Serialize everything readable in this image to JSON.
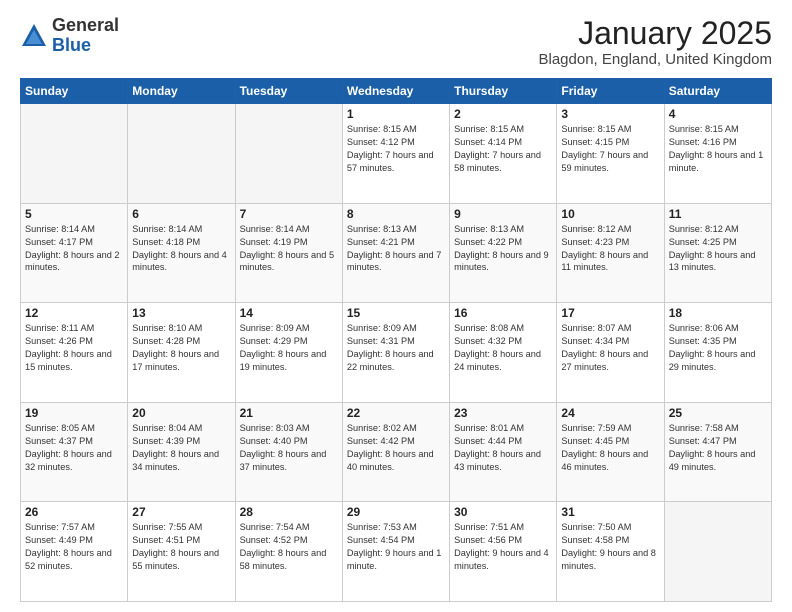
{
  "header": {
    "logo_general": "General",
    "logo_blue": "Blue",
    "title": "January 2025",
    "subtitle": "Blagdon, England, United Kingdom"
  },
  "weekdays": [
    "Sunday",
    "Monday",
    "Tuesday",
    "Wednesday",
    "Thursday",
    "Friday",
    "Saturday"
  ],
  "weeks": [
    [
      {
        "day": "",
        "info": ""
      },
      {
        "day": "",
        "info": ""
      },
      {
        "day": "",
        "info": ""
      },
      {
        "day": "1",
        "info": "Sunrise: 8:15 AM\nSunset: 4:12 PM\nDaylight: 7 hours and 57 minutes."
      },
      {
        "day": "2",
        "info": "Sunrise: 8:15 AM\nSunset: 4:14 PM\nDaylight: 7 hours and 58 minutes."
      },
      {
        "day": "3",
        "info": "Sunrise: 8:15 AM\nSunset: 4:15 PM\nDaylight: 7 hours and 59 minutes."
      },
      {
        "day": "4",
        "info": "Sunrise: 8:15 AM\nSunset: 4:16 PM\nDaylight: 8 hours and 1 minute."
      }
    ],
    [
      {
        "day": "5",
        "info": "Sunrise: 8:14 AM\nSunset: 4:17 PM\nDaylight: 8 hours and 2 minutes."
      },
      {
        "day": "6",
        "info": "Sunrise: 8:14 AM\nSunset: 4:18 PM\nDaylight: 8 hours and 4 minutes."
      },
      {
        "day": "7",
        "info": "Sunrise: 8:14 AM\nSunset: 4:19 PM\nDaylight: 8 hours and 5 minutes."
      },
      {
        "day": "8",
        "info": "Sunrise: 8:13 AM\nSunset: 4:21 PM\nDaylight: 8 hours and 7 minutes."
      },
      {
        "day": "9",
        "info": "Sunrise: 8:13 AM\nSunset: 4:22 PM\nDaylight: 8 hours and 9 minutes."
      },
      {
        "day": "10",
        "info": "Sunrise: 8:12 AM\nSunset: 4:23 PM\nDaylight: 8 hours and 11 minutes."
      },
      {
        "day": "11",
        "info": "Sunrise: 8:12 AM\nSunset: 4:25 PM\nDaylight: 8 hours and 13 minutes."
      }
    ],
    [
      {
        "day": "12",
        "info": "Sunrise: 8:11 AM\nSunset: 4:26 PM\nDaylight: 8 hours and 15 minutes."
      },
      {
        "day": "13",
        "info": "Sunrise: 8:10 AM\nSunset: 4:28 PM\nDaylight: 8 hours and 17 minutes."
      },
      {
        "day": "14",
        "info": "Sunrise: 8:09 AM\nSunset: 4:29 PM\nDaylight: 8 hours and 19 minutes."
      },
      {
        "day": "15",
        "info": "Sunrise: 8:09 AM\nSunset: 4:31 PM\nDaylight: 8 hours and 22 minutes."
      },
      {
        "day": "16",
        "info": "Sunrise: 8:08 AM\nSunset: 4:32 PM\nDaylight: 8 hours and 24 minutes."
      },
      {
        "day": "17",
        "info": "Sunrise: 8:07 AM\nSunset: 4:34 PM\nDaylight: 8 hours and 27 minutes."
      },
      {
        "day": "18",
        "info": "Sunrise: 8:06 AM\nSunset: 4:35 PM\nDaylight: 8 hours and 29 minutes."
      }
    ],
    [
      {
        "day": "19",
        "info": "Sunrise: 8:05 AM\nSunset: 4:37 PM\nDaylight: 8 hours and 32 minutes."
      },
      {
        "day": "20",
        "info": "Sunrise: 8:04 AM\nSunset: 4:39 PM\nDaylight: 8 hours and 34 minutes."
      },
      {
        "day": "21",
        "info": "Sunrise: 8:03 AM\nSunset: 4:40 PM\nDaylight: 8 hours and 37 minutes."
      },
      {
        "day": "22",
        "info": "Sunrise: 8:02 AM\nSunset: 4:42 PM\nDaylight: 8 hours and 40 minutes."
      },
      {
        "day": "23",
        "info": "Sunrise: 8:01 AM\nSunset: 4:44 PM\nDaylight: 8 hours and 43 minutes."
      },
      {
        "day": "24",
        "info": "Sunrise: 7:59 AM\nSunset: 4:45 PM\nDaylight: 8 hours and 46 minutes."
      },
      {
        "day": "25",
        "info": "Sunrise: 7:58 AM\nSunset: 4:47 PM\nDaylight: 8 hours and 49 minutes."
      }
    ],
    [
      {
        "day": "26",
        "info": "Sunrise: 7:57 AM\nSunset: 4:49 PM\nDaylight: 8 hours and 52 minutes."
      },
      {
        "day": "27",
        "info": "Sunrise: 7:55 AM\nSunset: 4:51 PM\nDaylight: 8 hours and 55 minutes."
      },
      {
        "day": "28",
        "info": "Sunrise: 7:54 AM\nSunset: 4:52 PM\nDaylight: 8 hours and 58 minutes."
      },
      {
        "day": "29",
        "info": "Sunrise: 7:53 AM\nSunset: 4:54 PM\nDaylight: 9 hours and 1 minute."
      },
      {
        "day": "30",
        "info": "Sunrise: 7:51 AM\nSunset: 4:56 PM\nDaylight: 9 hours and 4 minutes."
      },
      {
        "day": "31",
        "info": "Sunrise: 7:50 AM\nSunset: 4:58 PM\nDaylight: 9 hours and 8 minutes."
      },
      {
        "day": "",
        "info": ""
      }
    ]
  ]
}
